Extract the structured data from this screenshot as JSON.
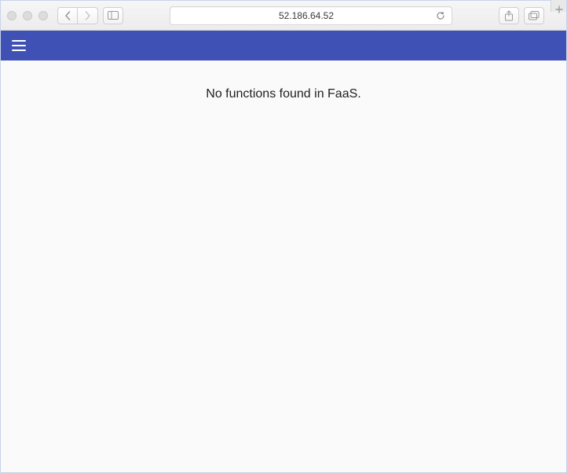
{
  "browser": {
    "address": "52.186.64.52"
  },
  "app": {
    "empty_message": "No functions found in FaaS."
  }
}
